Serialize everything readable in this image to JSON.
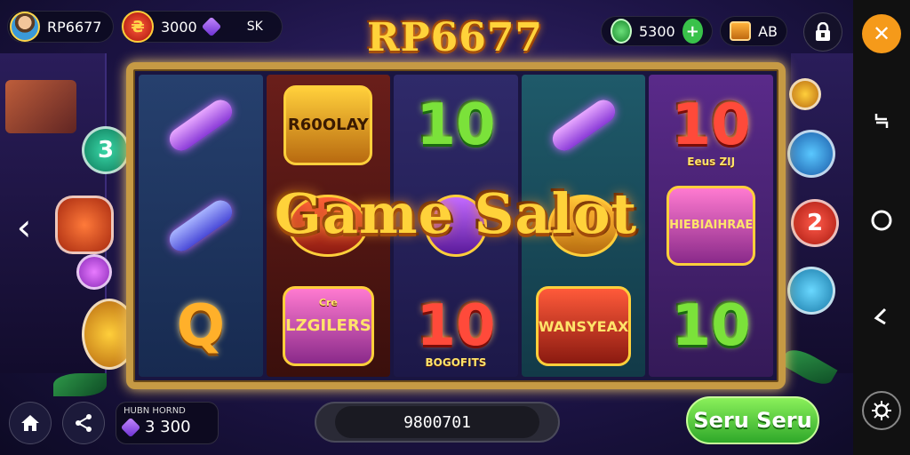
{
  "player": {
    "name": "RP6677",
    "coins": "3000",
    "currency_code": "SK"
  },
  "wallet": {
    "green_coins": "5300",
    "chest_label": "AB"
  },
  "logo": {
    "text": "RP6677"
  },
  "title": {
    "text": "Game Salot"
  },
  "reels": [
    {
      "symbols": [
        {
          "kind": "pipe"
        },
        {
          "kind": "pipe"
        },
        {
          "kind": "number",
          "text": "Q"
        }
      ]
    },
    {
      "symbols": [
        {
          "kind": "badge",
          "text": "R60OLAY"
        },
        {
          "kind": "badge",
          "text": ""
        },
        {
          "kind": "badge",
          "text": "LZGILERS",
          "sub": "Cre"
        }
      ]
    },
    {
      "symbols": [
        {
          "kind": "number",
          "text": "10"
        },
        {
          "kind": "badge",
          "text": ""
        },
        {
          "kind": "number",
          "text": "10",
          "sub": "BOGOFITS"
        }
      ]
    },
    {
      "symbols": [
        {
          "kind": "pipe"
        },
        {
          "kind": "badge",
          "text": ""
        },
        {
          "kind": "badge",
          "text": "WANSYEAX"
        }
      ]
    },
    {
      "symbols": [
        {
          "kind": "number",
          "text": "10",
          "sub": "Eeus ZIJ"
        },
        {
          "kind": "badge",
          "text": "HIEBIAIHRAE"
        },
        {
          "kind": "number",
          "text": "10"
        }
      ]
    }
  ],
  "left_coin": {
    "text": "3"
  },
  "right_coins": [
    "",
    "2",
    ""
  ],
  "bottom": {
    "balance_label": "HUBN HORND",
    "balance_value": "3 300",
    "bet_value": "9800701",
    "spin_label": "Seru Seru"
  },
  "colors": {
    "accent_gold": "#ffd23a",
    "spin_green": "#2fa82a",
    "close_orange": "#f59a1a"
  },
  "icons": {
    "home": "home-icon",
    "share": "share-icon",
    "lock": "lock-icon",
    "close": "close-icon",
    "settings": "settings-icon"
  }
}
